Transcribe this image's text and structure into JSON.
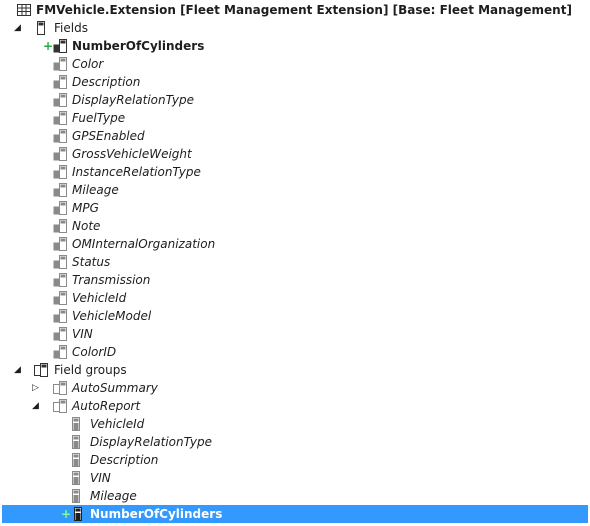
{
  "root": {
    "label": "FMVehicle.Extension [Fleet Management Extension] [Base: Fleet Management]",
    "icon": "table-icon"
  },
  "fields_node": {
    "label": "Fields",
    "icon": "fields-folder-icon",
    "expand_glyph": "◢"
  },
  "new_field": {
    "label": "NumberOfCylinders",
    "icon": "field-icon",
    "added_glyph": "+"
  },
  "base_fields": [
    "Color",
    "Description",
    "DisplayRelationType",
    "FuelType",
    "GPSEnabled",
    "GrossVehicleWeight",
    "InstanceRelationType",
    "Mileage",
    "MPG",
    "Note",
    "OMInternalOrganization",
    "Status",
    "Transmission",
    "VehicleId",
    "VehicleModel",
    "VIN",
    "ColorID"
  ],
  "field_groups_node": {
    "label": "Field groups",
    "icon": "field-groups-icon",
    "expand_glyph": "◢"
  },
  "autosummary": {
    "label": "AutoSummary",
    "icon": "field-group-icon",
    "expand_glyph": "▷"
  },
  "autoreport": {
    "label": "AutoReport",
    "icon": "field-group-icon",
    "expand_glyph": "◢"
  },
  "autoreport_fields": [
    "VehicleId",
    "DisplayRelationType",
    "Description",
    "VIN",
    "Mileage"
  ],
  "autoreport_new": {
    "label": "NumberOfCylinders",
    "added_glyph": "+"
  },
  "colors": {
    "selection": "#3399ff",
    "added_marker": "#27a844",
    "icon_base": "#8a8a8a",
    "icon_dark": "#333333"
  }
}
